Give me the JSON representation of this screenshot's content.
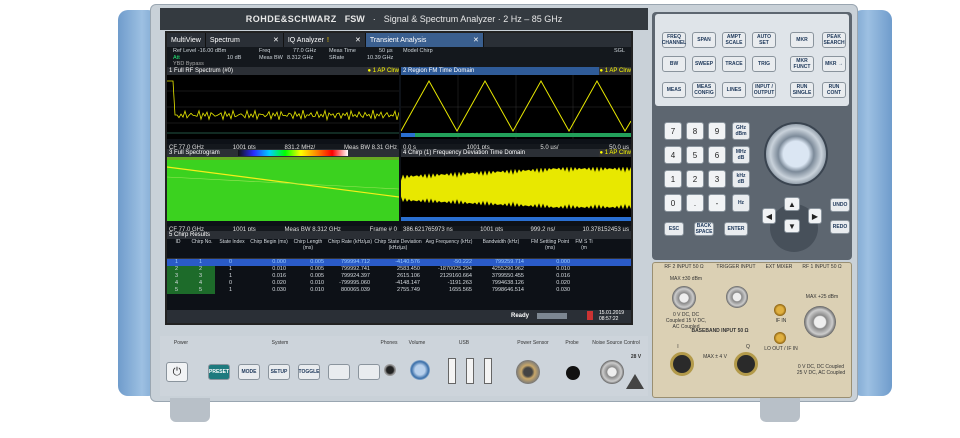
{
  "header": {
    "brand": "ROHDE&SCHWARZ",
    "model": "FSW",
    "separator": "·",
    "title": "Signal & Spectrum Analyzer · 2 Hz – 85 GHz"
  },
  "tabs": [
    {
      "label": "MultiView"
    },
    {
      "label": "Spectrum"
    },
    {
      "label": "IQ Analyzer"
    },
    {
      "label": "Transient Analysis"
    }
  ],
  "settings": {
    "ref_level": "Ref Level -16.00 dBm",
    "att": "Att",
    "att_val": "10 dB",
    "ybw": "YBD Bypass",
    "freq_l": "Freq",
    "freq_v": "77.0 GHz",
    "meas_bw_l": "Meas BW",
    "meas_bw_v": "8.312 GHz",
    "meas_time_l": "Meas Time",
    "meas_time_v": "50 µs",
    "srate_l": "SRate",
    "srate_v": "10.39 GHz",
    "model": "Model Chirp",
    "sgl": "SGL"
  },
  "panels": {
    "p1": {
      "title": "1 Full RF Spectrum (#0)",
      "mark": "● 1 AP Clrw",
      "cf": "CF 77.0 GHz",
      "pts": "1001 pts",
      "span": "831.2 MHz/",
      "bw": "Meas BW 8.31 GHz"
    },
    "p2": {
      "title": "2 Region FM Time Domain",
      "mark": "● 1 AP Clrw",
      "t0": "0.0 s",
      "pts": "1001 pts",
      "div": "5.0 µs/",
      "t1": "50.0 µs"
    },
    "p3": {
      "title": "3 Full Spectrogram",
      "cf": "CF 77.0 GHz",
      "pts": "1001 pts",
      "bw": "Meas BW 8.312 GHz",
      "frame": "Frame # 0"
    },
    "p4": {
      "title": "4 Chirp (1) Frequency Deviation Time Domain",
      "mark": "● 1 AP Clrw",
      "t0": "386.621765973 ns",
      "pts": "1001 pts",
      "div": "999.2 ns/",
      "t1": "10.378152453 µs"
    }
  },
  "table": {
    "title": "5 Chirp Results",
    "headers": [
      "ID",
      "Chirp No.",
      "State Index",
      "Chirp Begin (ms)",
      "Chirp Length (ms)",
      "Chirp Rate (kHz/µs)",
      "Chirp State Deviation (kHz/µs)",
      "Avg Frequency (kHz)",
      "Bandwidth (kHz)",
      "FM Settling Point (ms)",
      "FM S Ti (m"
    ],
    "rows": [
      [
        "1",
        "1",
        "0",
        "0.000",
        "0.005",
        "799994.712",
        "-4140.576",
        "-50.222",
        "799259.714",
        "0.000",
        ""
      ],
      [
        "2",
        "2",
        "1",
        "0.010",
        "0.005",
        "799992.741",
        "2583.450",
        "-1870025.294",
        "4255290.962",
        "0.010",
        ""
      ],
      [
        "3",
        "3",
        "1",
        "0.016",
        "0.005",
        "799924.397",
        "2615.106",
        "2129160.664",
        "3799550.455",
        "0.016",
        ""
      ],
      [
        "4",
        "4",
        "0",
        "0.020",
        "0.010",
        "-799995.060",
        "-4148.147",
        "-1191.263",
        "7994638.126",
        "0.020",
        ""
      ],
      [
        "5",
        "5",
        "1",
        "0.030",
        "0.010",
        "800065.039",
        "2755.749",
        "1655.565",
        "7998646.514",
        "0.030",
        ""
      ]
    ]
  },
  "status": {
    "ready": "Ready",
    "date": "15.01.2019",
    "time": "08:57:22"
  },
  "buttons": {
    "row1": [
      "FREQ CHANNEL",
      "SPAN",
      "AMPT SCALE",
      "AUTO SET",
      "MKR",
      "PEAK SEARCH"
    ],
    "row2": [
      "BW",
      "SWEEP",
      "TRACE",
      "TRIG",
      "MKR FUNCT",
      "MKR →"
    ],
    "row3": [
      "MEAS",
      "MEAS CONFIG",
      "LINES",
      "INPUT / OUTPUT",
      "RUN SINGLE",
      "RUN CONT"
    ],
    "keys": [
      "7",
      "8",
      "9",
      "4",
      "5",
      "6",
      "1",
      "2",
      "3",
      "0",
      ".",
      "-"
    ],
    "units": [
      "GHz dBm",
      "MHz dB",
      "kHz dB",
      "Hz"
    ],
    "esc": "ESC",
    "back": "BACK SPACE",
    "enter": "ENTER",
    "undo": "UNDO",
    "redo": "REDO"
  },
  "front": {
    "power": "Power",
    "system": "System",
    "phones": "Phones",
    "volume": "Volume",
    "usb": "USB",
    "power_sensor": "Power Sensor",
    "probe": "Probe",
    "noise": "Noise Source Control",
    "noise_v": "28 V",
    "sys_keys": [
      "PRESET",
      "MODE",
      "SETUP",
      "TOGGLE",
      "",
      ""
    ]
  },
  "ports": {
    "rf2": "RF 2 INPUT 50 Ω",
    "trigger": "TRIGGER INPUT",
    "ext_mixer": "EXT MIXER",
    "rf1": "RF 1 INPUT 50 Ω",
    "max_rf2": "MAX ±30 dBm",
    "max_rf1": "MAX +25 dBm",
    "if_in": "IF IN",
    "lo_out": "LO OUT / IF IN",
    "baseband": "BASEBAND INPUT 50 Ω",
    "bb_i": "I",
    "bb_q": "Q",
    "max_bb": "MAX ± 4 V",
    "coupling": "0 V DC, DC Coupled 25 V DC, AC Coupled",
    "dc_note": "0 V DC, DC Coupled 15 V DC, AC Coupled"
  }
}
